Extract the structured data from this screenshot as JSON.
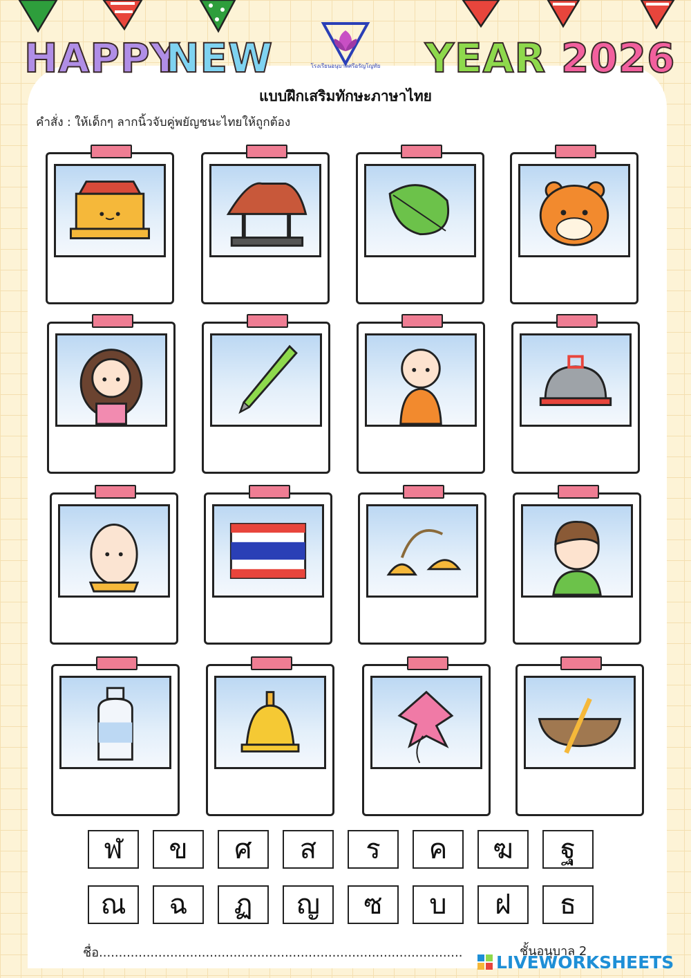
{
  "colors": {
    "happy": "#b08ee6",
    "new": "#7fd3f1",
    "year": "#8ed94c",
    "number": "#f2609e",
    "brand": "#1e8fd6"
  },
  "title": {
    "word1": "HAPPY",
    "word2": "NEW",
    "word3": "YEAR",
    "word4": "2026"
  },
  "logo_text": "โรงเรียนอนุบาลศรีอรัญโญทัย",
  "heading": "แบบฝึกเสริมทักษะภาษาไทย",
  "instruction": "คำสั่ง : ให้เด็กๆ ลากนิ้วจับคู่พยัญชนะไทยให้ถูกต้อง",
  "cards": [
    {
      "icon": "treasure-box-icon"
    },
    {
      "icon": "thai-pavilion-icon"
    },
    {
      "icon": "leaf-icon"
    },
    {
      "icon": "tiger-icon"
    },
    {
      "icon": "girl-icon"
    },
    {
      "icon": "pen-icon"
    },
    {
      "icon": "monk-icon"
    },
    {
      "icon": "food-cover-icon"
    },
    {
      "icon": "egg-icon"
    },
    {
      "icon": "thai-flag-icon"
    },
    {
      "icon": "cymbals-icon"
    },
    {
      "icon": "boy-icon"
    },
    {
      "icon": "bottle-icon"
    },
    {
      "icon": "bell-icon"
    },
    {
      "icon": "kite-icon"
    },
    {
      "icon": "boat-icon"
    }
  ],
  "letters_row1": [
    "ฬ",
    "ข",
    "ศ",
    "ส",
    "ร",
    "ค",
    "ฆ",
    "ฐ"
  ],
  "letters_row2": [
    "ณ",
    "ฉ",
    "ฏ",
    "ญ",
    "ซ",
    "บ",
    "ฝ",
    "ธ"
  ],
  "footer": {
    "name_label": "ชื่อ............................................................................................",
    "class_label": "ชั้นอนุบาล 2"
  },
  "brand": "LIVEWORKSHEETS"
}
